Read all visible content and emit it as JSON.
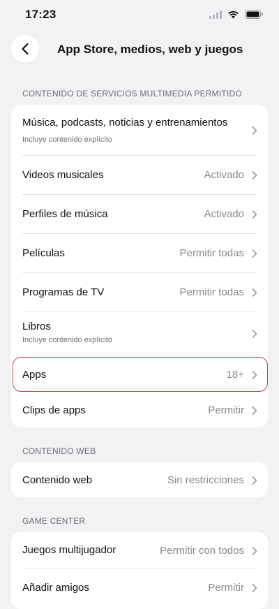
{
  "status_bar": {
    "time": "17:23"
  },
  "nav": {
    "title": "App Store, medios, web y juegos"
  },
  "sections": [
    {
      "header": "CONTENIDO DE SERVICIOS MULTIMEDIA PERMITIDO",
      "rows": [
        {
          "label": "Música, podcasts, noticias y entrenamientos",
          "sub": "Incluye contenido explícito",
          "value": ""
        },
        {
          "label": "Videos musicales",
          "sub": "",
          "value": "Activado"
        },
        {
          "label": "Perfiles de música",
          "sub": "",
          "value": "Activado"
        },
        {
          "label": "Películas",
          "sub": "",
          "value": "Permitir todas"
        },
        {
          "label": "Programas de TV",
          "sub": "",
          "value": "Permitir todas"
        },
        {
          "label": "Libros",
          "sub": "Incluye contenido explícito",
          "value": ""
        },
        {
          "label": "Apps",
          "sub": "",
          "value": "18+"
        },
        {
          "label": "Clips de apps",
          "sub": "",
          "value": "Permitir"
        }
      ]
    },
    {
      "header": "CONTENIDO WEB",
      "rows": [
        {
          "label": "Contenido web",
          "sub": "",
          "value": "Sin restricciones"
        }
      ]
    },
    {
      "header": "GAME CENTER",
      "rows": [
        {
          "label": "Juegos multijugador",
          "sub": "",
          "value": "Permitir con todos"
        },
        {
          "label": "Añadir amigos",
          "sub": "",
          "value": "Permitir"
        }
      ]
    }
  ],
  "colors": {
    "highlight": "#e0383e",
    "background": "#f2f2f5",
    "card": "#ffffff"
  },
  "icons": {
    "back": "chevron-left-icon",
    "row": "chevron-right-icon",
    "signal": "signal-icon",
    "wifi": "wifi-icon",
    "battery": "battery-icon"
  }
}
